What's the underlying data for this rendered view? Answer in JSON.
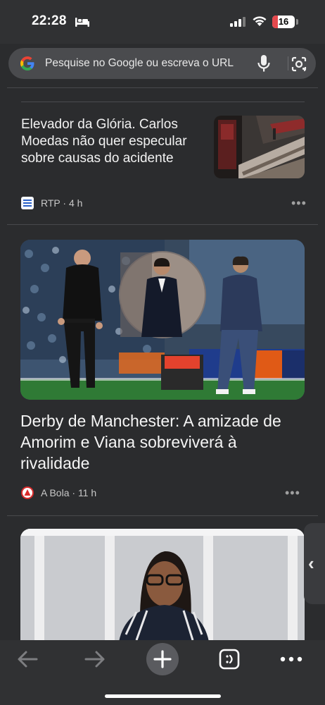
{
  "status_bar": {
    "time": "22:28",
    "battery": "16",
    "battery_color": "#e5484d"
  },
  "search": {
    "placeholder": "Pesquise no Google ou escreva o URL"
  },
  "articles": [
    {
      "title": "Elevador da Glória. Carlos Moedas não quer especular sobre causas do acidente",
      "source": "RTP",
      "age": "4 h",
      "separator": "·"
    },
    {
      "title": "Derby de Manchester: A amizade de Amorim e Viana sobreviverá à rivalidade",
      "source": "A Bola",
      "age": "11 h",
      "separator": "·"
    }
  ],
  "more_glyph": "•••",
  "side_tab": {
    "glyph": "‹"
  },
  "toolbar": {
    "back_icon": "arrow-left-icon",
    "forward_icon": "arrow-right-icon",
    "new_tab_icon": "plus-icon",
    "tabs_icon": "tab-switcher-icon",
    "menu_icon": "more-icon"
  },
  "colors": {
    "background": "#2b2c2e",
    "search_bar": "#4a4b4e",
    "text": "#f2f2f2",
    "meta_text": "#c8c8c8"
  }
}
